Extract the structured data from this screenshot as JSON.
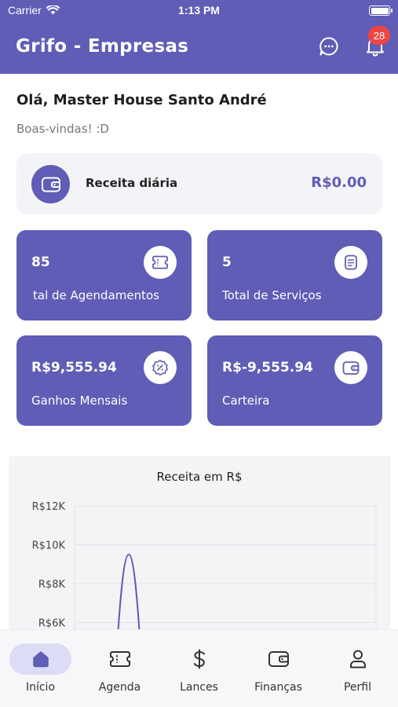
{
  "status_bar": {
    "carrier": "Carrier",
    "time": "1:13 PM"
  },
  "header": {
    "title": "Grifo - Empresas",
    "notification_count": "28"
  },
  "greeting": {
    "title": "Olá, Master House Santo André",
    "subtitle": "Boas-vindas! :D"
  },
  "daily_revenue": {
    "label": "Receita diária",
    "value": "R$0.00"
  },
  "stats": [
    {
      "value": "85",
      "label": "tal de Agendamentos",
      "icon": "ticket-icon"
    },
    {
      "value": "5",
      "label": "Total de Serviços",
      "icon": "document-icon"
    },
    {
      "value": "R$9,555.94",
      "label": "Ganhos Mensais",
      "icon": "discount-icon"
    },
    {
      "value": "R$-9,555.94",
      "label": "Carteira",
      "icon": "wallet-icon"
    }
  ],
  "chart_data": {
    "type": "line",
    "title": "Receita em R$",
    "y_tick_labels": [
      "R$12K",
      "R$10K",
      "R$8K",
      "R$6K"
    ],
    "ylim": [
      6000,
      12000
    ],
    "series": [
      {
        "values": [
          9500
        ]
      }
    ],
    "grid": true,
    "color": "#5f5db5"
  },
  "tabs": [
    {
      "label": "Início",
      "icon": "home-icon",
      "active": true
    },
    {
      "label": "Agenda",
      "icon": "ticket-icon",
      "active": false
    },
    {
      "label": "Lances",
      "icon": "dollar-icon",
      "active": false
    },
    {
      "label": "Finanças",
      "icon": "wallet-icon",
      "active": false
    },
    {
      "label": "Perfil",
      "icon": "user-icon",
      "active": false
    }
  ],
  "colors": {
    "primary": "#5f5db5",
    "badge": "#ef4444",
    "card_bg": "#f3f4f7",
    "tab_active_bg": "#dcdcf5"
  }
}
